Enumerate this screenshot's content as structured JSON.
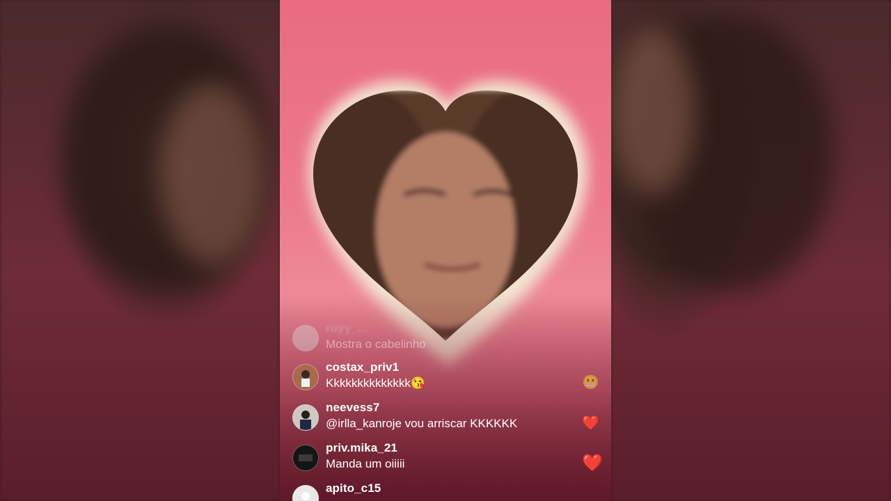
{
  "comments": [
    {
      "username": "ruyy_...",
      "text": "Mostra o cabelinho",
      "reaction": ""
    },
    {
      "username": "costax_priv1",
      "text": "Kkkkkkkkkkkkkk😘",
      "reaction": "😬"
    },
    {
      "username": "neevess7",
      "text": "@irlla_kanroje vou arriscar KKKKKK",
      "reaction": "❤️"
    },
    {
      "username": "priv.mika_21",
      "text": "Manda um oiiiii",
      "reaction": "❤️"
    },
    {
      "username": "apito_c15",
      "text": "",
      "reaction": ""
    }
  ],
  "colors": {
    "background_pink": "#e96b7f",
    "comment_text": "#ffffff",
    "heart_reaction": "#e8232f"
  }
}
